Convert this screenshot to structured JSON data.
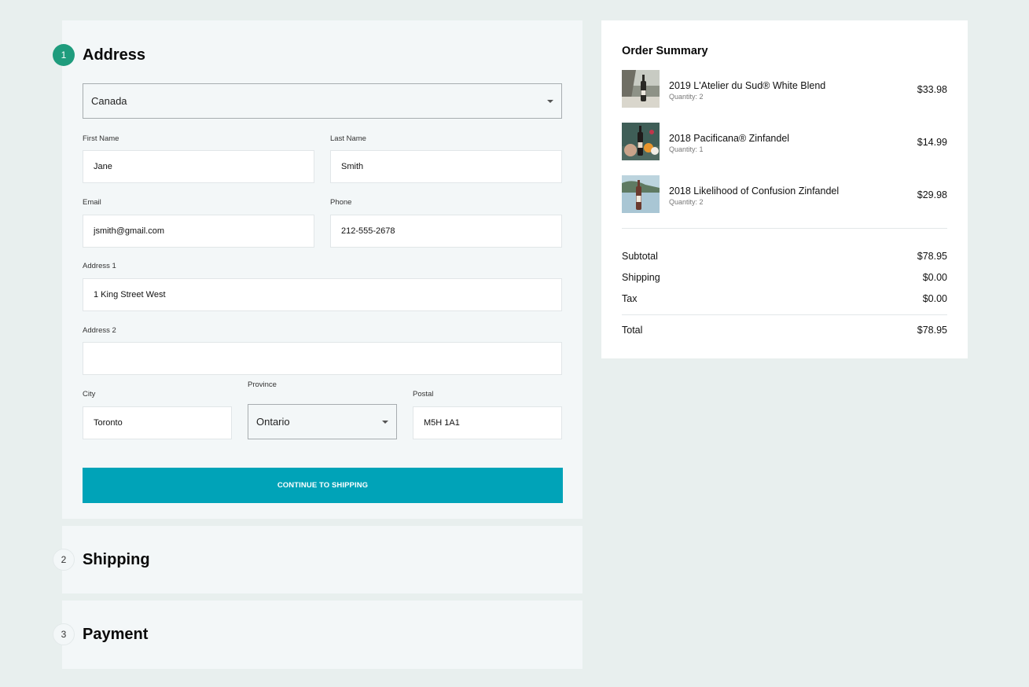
{
  "steps": [
    {
      "number": "1",
      "title": "Address"
    },
    {
      "number": "2",
      "title": "Shipping"
    },
    {
      "number": "3",
      "title": "Payment"
    }
  ],
  "address_form": {
    "country": "Canada",
    "first_name": {
      "label": "First Name",
      "value": "Jane"
    },
    "last_name": {
      "label": "Last Name",
      "value": "Smith"
    },
    "email": {
      "label": "Email",
      "value": "jsmith@gmail.com"
    },
    "phone": {
      "label": "Phone",
      "value": "212-555-2678"
    },
    "address1": {
      "label": "Address 1",
      "value": "1 King Street West"
    },
    "address2": {
      "label": "Address 2",
      "value": ""
    },
    "city": {
      "label": "City",
      "value": "Toronto"
    },
    "province": {
      "label": "Province",
      "value": "Ontario"
    },
    "postal": {
      "label": "Postal",
      "value": "M5H 1A1"
    },
    "continue_label": "CONTINUE TO SHIPPING"
  },
  "order_summary": {
    "title": "Order Summary",
    "items": [
      {
        "name": "2019 L'Atelier du Sud® White Blend",
        "quantity": "Quantity: 2",
        "price": "$33.98"
      },
      {
        "name": "2018 Pacificana® Zinfandel",
        "quantity": "Quantity: 1",
        "price": "$14.99"
      },
      {
        "name": "2018 Likelihood of Confusion Zinfandel",
        "quantity": "Quantity: 2",
        "price": "$29.98"
      }
    ],
    "subtotal": {
      "label": "Subtotal",
      "value": "$78.95"
    },
    "shipping": {
      "label": "Shipping",
      "value": "$0.00"
    },
    "tax": {
      "label": "Tax",
      "value": "$0.00"
    },
    "total": {
      "label": "Total",
      "value": "$78.95"
    }
  },
  "colors": {
    "background": "#e8efee",
    "panel": "#f3f7f8",
    "accent_button": "#00a3b8",
    "active_step": "#1f9c7d"
  }
}
